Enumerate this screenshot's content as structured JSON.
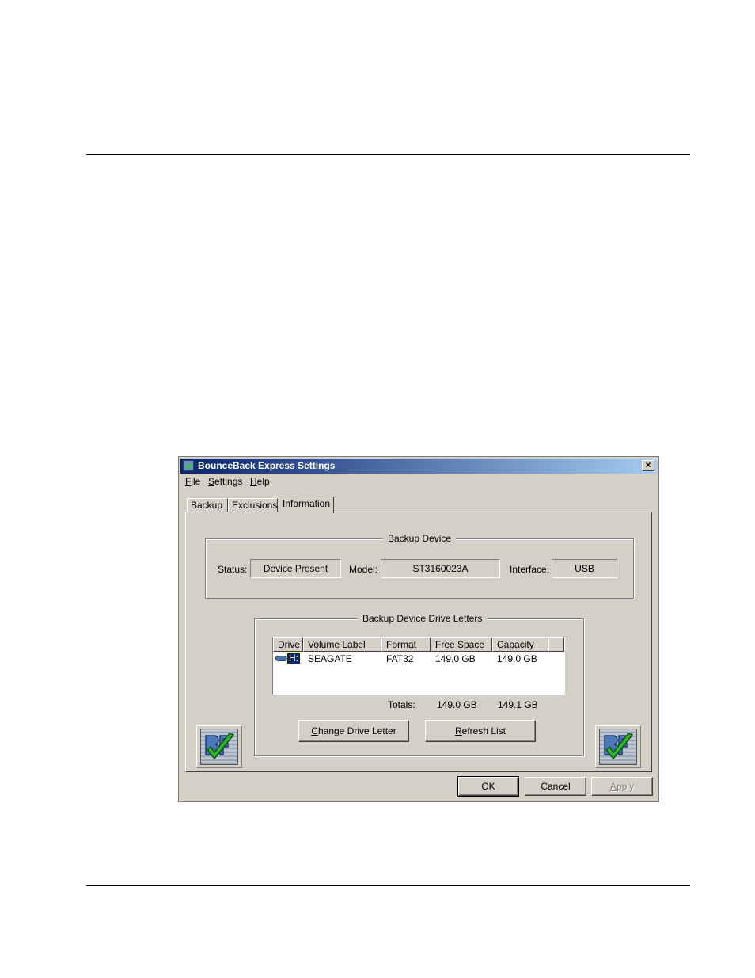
{
  "window": {
    "title": "BounceBack Express Settings",
    "close_glyph": "×",
    "menu": [
      {
        "label": "File",
        "mnemonic": "F",
        "rest": "ile"
      },
      {
        "label": "Settings",
        "mnemonic": "S",
        "rest": "ettings"
      },
      {
        "label": "Help",
        "mnemonic": "H",
        "rest": "elp"
      }
    ],
    "tabs": [
      "Backup",
      "Exclusions",
      "Information"
    ],
    "active_tab": "Information"
  },
  "backup_device": {
    "legend": "Backup Device",
    "status_label": "Status:",
    "status_value": "Device Present",
    "model_label": "Model:",
    "model_value": "ST3160023A",
    "interface_label": "Interface:",
    "interface_value": "USB"
  },
  "drive_letters": {
    "legend": "Backup Device Drive Letters",
    "columns": [
      "Drive",
      "Volume Label",
      "Format",
      "Free Space",
      "Capacity"
    ],
    "rows": [
      {
        "drive": "H:",
        "volume_label": "SEAGATE",
        "format": "FAT32",
        "free_space": "149.0 GB",
        "capacity": "149.0 GB"
      }
    ],
    "totals_label": "Totals:",
    "totals_free": "149.0 GB",
    "totals_capacity": "149.1 GB",
    "change_button": {
      "mnemonic": "C",
      "rest": "hange Drive Letter"
    },
    "refresh_button": {
      "mnemonic": "R",
      "rest": "efresh List"
    }
  },
  "footer": {
    "ok": "OK",
    "cancel": "Cancel",
    "apply": {
      "mnemonic": "A",
      "rest": "pply"
    }
  },
  "icons": {
    "app": "app-icon",
    "drive": "drive-icon",
    "logo": "bounceback-logo-icon"
  }
}
